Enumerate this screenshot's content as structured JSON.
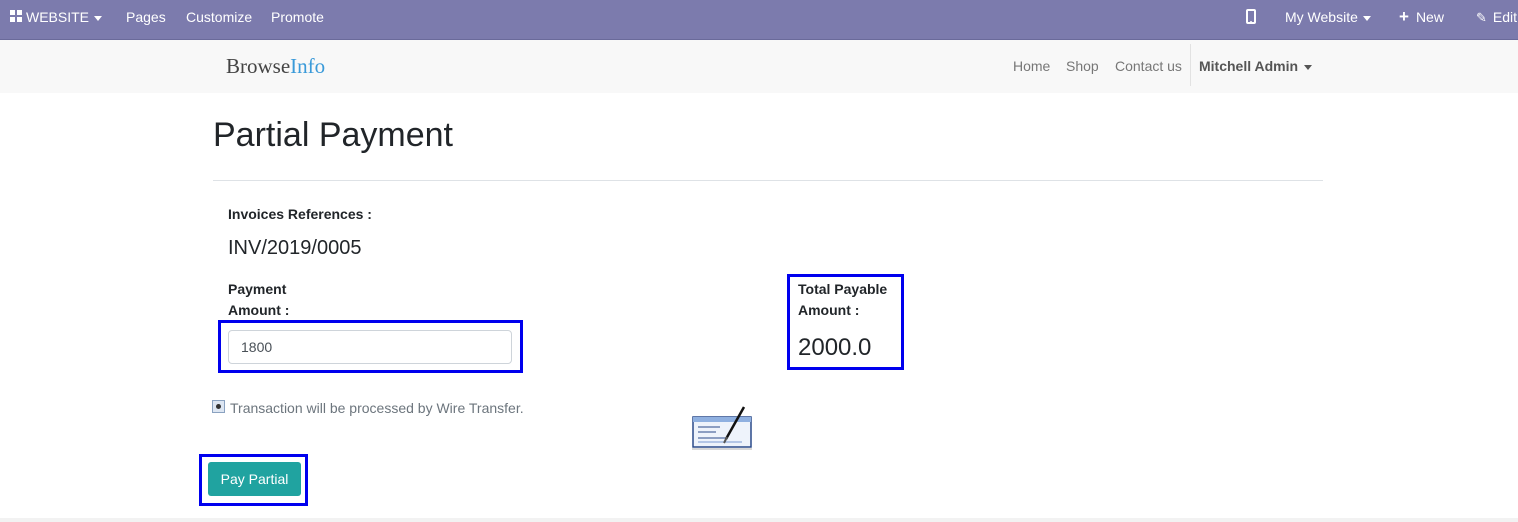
{
  "topbar": {
    "website_label": "WEBSITE",
    "pages_label": "Pages",
    "customize_label": "Customize",
    "promote_label": "Promote",
    "my_website_label": "My Website",
    "new_label": "New",
    "edit_label": "Edit",
    "background_color": "#7c7bad"
  },
  "navbar": {
    "brand_part1": "Browse",
    "brand_part2": "Info",
    "links": [
      "Home",
      "Shop",
      "Contact us"
    ],
    "user": "Mitchell Admin"
  },
  "page": {
    "title": "Partial Payment",
    "invoice_label": "Invoices References :",
    "invoice_ref": "INV/2019/0005",
    "payment_label_line1": "Payment",
    "payment_label_line2": "Amount :",
    "payment_value": "1800",
    "total_label_line1": "Total Payable",
    "total_label_line2": "Amount :",
    "total_value": "2000.0",
    "payment_method_text": "Transaction will be processed by Wire Transfer.",
    "pay_button": "Pay Partial",
    "button_color": "#20a3a0",
    "highlight_color": "#0000ee"
  }
}
